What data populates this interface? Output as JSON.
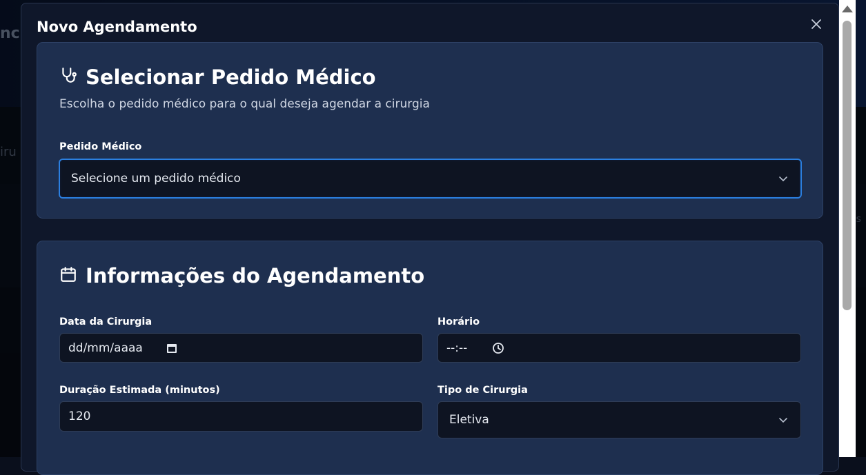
{
  "background": {
    "logo_fragment": "nc",
    "left_fragment": "iru",
    "right_fragment": "os"
  },
  "modal": {
    "title": "Novo Agendamento",
    "close_icon": "close-icon"
  },
  "medical_order_card": {
    "icon": "stethoscope-icon",
    "title": "Selecionar Pedido Médico",
    "description": "Escolha o pedido médico para o qual deseja agendar a cirurgia",
    "field_label": "Pedido Médico",
    "select_placeholder": "Selecione um pedido médico"
  },
  "schedule_card": {
    "icon": "calendar-icon",
    "title": "Informações do Agendamento",
    "date": {
      "label": "Data da Cirurgia",
      "placeholder": "dd/mm/aaaa"
    },
    "time": {
      "label": "Horário",
      "placeholder": "--:--"
    },
    "duration": {
      "label": "Duração Estimada (minutos)",
      "value": "120"
    },
    "surgery_type": {
      "label": "Tipo de Cirurgia",
      "value": "Eletiva"
    }
  },
  "colors": {
    "focus_ring": "#2b7fe0",
    "card_bg": "#1e2f4f",
    "modal_bg": "#0f172a"
  }
}
